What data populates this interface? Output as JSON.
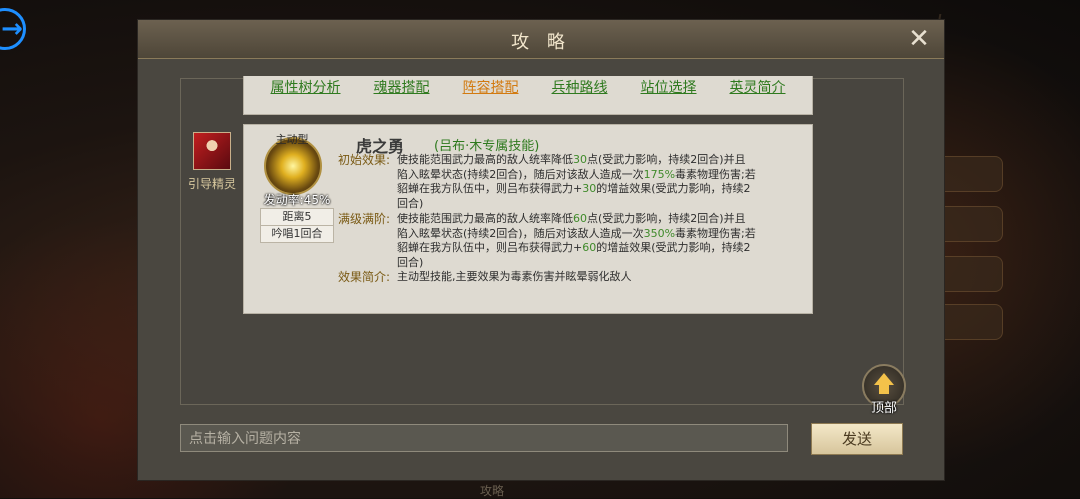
{
  "dialog": {
    "title": "攻 略"
  },
  "tabs": [
    {
      "label": "属性树分析",
      "active": false
    },
    {
      "label": "魂器搭配",
      "active": false
    },
    {
      "label": "阵容搭配",
      "active": true
    },
    {
      "label": "兵种路线",
      "active": false
    },
    {
      "label": "站位选择",
      "active": false
    },
    {
      "label": "英灵简介",
      "active": false
    }
  ],
  "guide": {
    "label": "引导精灵"
  },
  "skill": {
    "type": "主动型",
    "trigger_rate": "发动率:45%",
    "distance": "距离5",
    "chant": "吟唱1回合",
    "name": "虎之勇",
    "tag": "(吕布·木专属技能)",
    "initial_label": "初始效果:",
    "initial_lines": [
      [
        "使技能范围武力最高的敌人统率降低",
        "30",
        "点(受武力影响，持续2回合)并且"
      ],
      [
        "陷入眩晕状态(持续2回合)，随后对该敌人造成一次",
        "175%",
        "毒素物理伤害;若"
      ],
      [
        "貂蝉在我方队伍中，则吕布获得武力+",
        "30",
        "的增益效果(受武力影响，持续2"
      ],
      [
        "回合)",
        "",
        ""
      ]
    ],
    "max_label": "满级满阶:",
    "max_lines": [
      [
        "使技能范围武力最高的敌人统率降低",
        "60",
        "点(受武力影响，持续2回合)并且"
      ],
      [
        "陷入眩晕状态(持续2回合)，随后对该敌人造成一次",
        "350%",
        "毒素物理伤害;若"
      ],
      [
        "貂蝉在我方队伍中，则吕布获得武力+",
        "60",
        "的增益效果(受武力影响，持续2"
      ],
      [
        "回合)",
        "",
        ""
      ]
    ],
    "summary_label": "效果简介:",
    "summary_text": "主动型技能,主要效果为毒素伤害并眩晕弱化敌人"
  },
  "top_button": {
    "label": "顶部"
  },
  "chat": {
    "placeholder": "点击输入问题内容",
    "send_label": "发送"
  },
  "background_text": "攻略"
}
